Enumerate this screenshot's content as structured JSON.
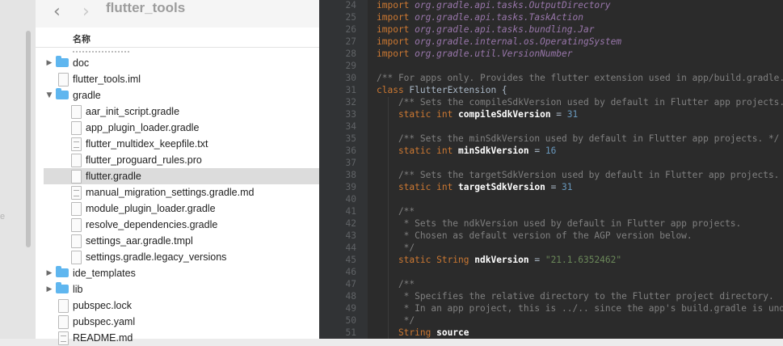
{
  "finder": {
    "title": "flutter_tools",
    "nav_back_glyph": "‹",
    "nav_forward_glyph": "›",
    "column_name": "名称",
    "sidebar_fragment": "e",
    "items": [
      {
        "label": "doc",
        "kind": "folder",
        "level": 0,
        "expanded": false
      },
      {
        "label": "flutter_tools.iml",
        "kind": "file",
        "level": 0
      },
      {
        "label": "gradle",
        "kind": "folder",
        "level": 0,
        "expanded": true
      },
      {
        "label": "aar_init_script.gradle",
        "kind": "file",
        "level": 1
      },
      {
        "label": "app_plugin_loader.gradle",
        "kind": "file",
        "level": 1
      },
      {
        "label": "flutter_multidex_keepfile.txt",
        "kind": "text",
        "level": 1
      },
      {
        "label": "flutter_proguard_rules.pro",
        "kind": "file",
        "level": 1
      },
      {
        "label": "flutter.gradle",
        "kind": "file",
        "level": 1,
        "selected": true
      },
      {
        "label": "manual_migration_settings.gradle.md",
        "kind": "text",
        "level": 1
      },
      {
        "label": "module_plugin_loader.gradle",
        "kind": "file",
        "level": 1
      },
      {
        "label": "resolve_dependencies.gradle",
        "kind": "file",
        "level": 1
      },
      {
        "label": "settings_aar.gradle.tmpl",
        "kind": "file",
        "level": 1
      },
      {
        "label": "settings.gradle.legacy_versions",
        "kind": "file",
        "level": 1
      },
      {
        "label": "ide_templates",
        "kind": "folder",
        "level": 0,
        "expanded": false
      },
      {
        "label": "lib",
        "kind": "folder",
        "level": 0,
        "expanded": false
      },
      {
        "label": "pubspec.lock",
        "kind": "file",
        "level": 0
      },
      {
        "label": "pubspec.yaml",
        "kind": "file",
        "level": 0
      },
      {
        "label": "README.md",
        "kind": "text",
        "level": 0
      }
    ]
  },
  "editor": {
    "colors": {
      "background": "#2b2b2b",
      "keyword": "#cc7832",
      "comment": "#629755",
      "number": "#6897bb",
      "string": "#6a8759"
    },
    "lines": [
      {
        "n": "24",
        "tokens": [
          {
            "t": "import ",
            "c": "kw"
          },
          {
            "t": "org.gradle.api.tasks.OutputDirectory",
            "c": "pk"
          }
        ]
      },
      {
        "n": "25",
        "tokens": [
          {
            "t": "import ",
            "c": "kw"
          },
          {
            "t": "org.gradle.api.tasks.TaskAction",
            "c": "pk"
          }
        ]
      },
      {
        "n": "26",
        "tokens": [
          {
            "t": "import ",
            "c": "kw"
          },
          {
            "t": "org.gradle.api.tasks.bundling.Jar",
            "c": "pk"
          }
        ]
      },
      {
        "n": "27",
        "tokens": [
          {
            "t": "import ",
            "c": "kw"
          },
          {
            "t": "org.gradle.internal.os.OperatingSystem",
            "c": "pk"
          }
        ]
      },
      {
        "n": "28",
        "tokens": [
          {
            "t": "import ",
            "c": "kw"
          },
          {
            "t": "org.gradle.util.VersionNumber",
            "c": "pk"
          }
        ]
      },
      {
        "n": "29",
        "tokens": []
      },
      {
        "n": "30",
        "tokens": [
          {
            "t": "/** For apps only. Provides the flutter extension used in app/build.gradle.",
            "c": "cmg"
          }
        ]
      },
      {
        "n": "31",
        "tokens": [
          {
            "t": "class ",
            "c": "kw"
          },
          {
            "t": "FlutterExtension {",
            "c": "id"
          }
        ]
      },
      {
        "n": "32",
        "tokens": [
          {
            "t": "    /** Sets the compileSdkVersion used by default in Flutter app projects. */",
            "c": "cmg"
          }
        ]
      },
      {
        "n": "33",
        "tokens": [
          {
            "t": "    static ",
            "c": "kw"
          },
          {
            "t": "int ",
            "c": "kw"
          },
          {
            "t": "compileSdkVersion",
            "c": "fld"
          },
          {
            "t": " = ",
            "c": "op"
          },
          {
            "t": "31",
            "c": "num"
          }
        ]
      },
      {
        "n": "34",
        "tokens": []
      },
      {
        "n": "35",
        "tokens": [
          {
            "t": "    /** Sets the minSdkVersion used by default in Flutter app projects. */",
            "c": "cmg"
          }
        ]
      },
      {
        "n": "36",
        "tokens": [
          {
            "t": "    static ",
            "c": "kw"
          },
          {
            "t": "int ",
            "c": "kw"
          },
          {
            "t": "minSdkVersion",
            "c": "fld"
          },
          {
            "t": " = ",
            "c": "op"
          },
          {
            "t": "16",
            "c": "num"
          }
        ]
      },
      {
        "n": "37",
        "tokens": []
      },
      {
        "n": "38",
        "tokens": [
          {
            "t": "    /** Sets the targetSdkVersion used by default in Flutter app projects. */",
            "c": "cmg"
          }
        ]
      },
      {
        "n": "39",
        "tokens": [
          {
            "t": "    static ",
            "c": "kw"
          },
          {
            "t": "int ",
            "c": "kw"
          },
          {
            "t": "targetSdkVersion",
            "c": "fld"
          },
          {
            "t": " = ",
            "c": "op"
          },
          {
            "t": "31",
            "c": "num"
          }
        ]
      },
      {
        "n": "40",
        "tokens": []
      },
      {
        "n": "41",
        "tokens": [
          {
            "t": "    /**",
            "c": "cmg"
          }
        ]
      },
      {
        "n": "42",
        "tokens": [
          {
            "t": "     * Sets the ndkVersion used by default in Flutter app projects.",
            "c": "cmg"
          }
        ]
      },
      {
        "n": "43",
        "tokens": [
          {
            "t": "     * Chosen as default version of the AGP version below.",
            "c": "cmg"
          }
        ]
      },
      {
        "n": "44",
        "tokens": [
          {
            "t": "     */",
            "c": "cmg"
          }
        ]
      },
      {
        "n": "45",
        "tokens": [
          {
            "t": "    static ",
            "c": "kw"
          },
          {
            "t": "String ",
            "c": "kw"
          },
          {
            "t": "ndkVersion",
            "c": "fld"
          },
          {
            "t": " = ",
            "c": "op"
          },
          {
            "t": "\"21.1.6352462\"",
            "c": "str"
          }
        ]
      },
      {
        "n": "46",
        "tokens": []
      },
      {
        "n": "47",
        "tokens": [
          {
            "t": "    /**",
            "c": "cmg"
          }
        ]
      },
      {
        "n": "48",
        "tokens": [
          {
            "t": "     * Specifies the relative directory to the Flutter project directory.",
            "c": "cmg"
          }
        ]
      },
      {
        "n": "49",
        "tokens": [
          {
            "t": "     * In an app project, this is ../.. since the app's build.gradle is under",
            "c": "cmg"
          }
        ]
      },
      {
        "n": "50",
        "tokens": [
          {
            "t": "     */",
            "c": "cmg"
          }
        ]
      },
      {
        "n": "51",
        "tokens": [
          {
            "t": "    String ",
            "c": "kw"
          },
          {
            "t": "source",
            "c": "fld"
          }
        ]
      }
    ]
  }
}
